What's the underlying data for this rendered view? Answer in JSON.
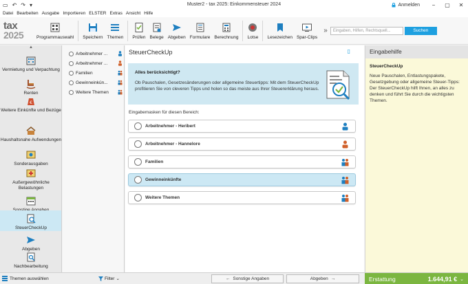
{
  "window": {
    "title": "Muster2 - tax 2025: Einkommensteuer 2024",
    "anmelden": "Anmelden"
  },
  "menu": [
    "Datei",
    "Bearbeiten",
    "Ausgabe",
    "Importieren",
    "ELSTER",
    "Extras",
    "Ansicht",
    "Hilfe"
  ],
  "logo": {
    "line1": "tax",
    "line2": "2025"
  },
  "toolbar": {
    "programmauswahl": "Programmauswahl",
    "speichern": "Speichern",
    "themen": "Themen",
    "pruefen": "Prüfen",
    "belege": "Belege",
    "abgeben": "Abgeben",
    "formulare": "Formulare",
    "berechnung": "Berechnung",
    "lotse": "Lotse",
    "lesezeichen": "Lesezeichen",
    "sparclips": "Spar-Clips",
    "more": "»",
    "search_placeholder": "Eingaben, Hilfen, Rechtsquell...",
    "search_button": "Suchen"
  },
  "sidebar": [
    {
      "label": "Vermietung und Verpachtung"
    },
    {
      "label": "Renten"
    },
    {
      "label": "Weitere Einkünfte und Bezüge"
    },
    {
      "label": "Haushaltsnahe Aufwendungen"
    },
    {
      "label": "Sonderausgaben"
    },
    {
      "label": "Außergewöhnliche Belastungen"
    },
    {
      "label": "Sonstige Angaben"
    },
    {
      "label": "SteuerCheckUp"
    },
    {
      "label": "Abgeben"
    },
    {
      "label": "Nachbearbeitung"
    }
  ],
  "navlist": [
    {
      "label": "Arbeitnehmer ..."
    },
    {
      "label": "Arbeitnehmer ..."
    },
    {
      "label": "Familien"
    },
    {
      "label": "Gewinneinkün..."
    },
    {
      "label": "Weitere Themen"
    }
  ],
  "content": {
    "title": "SteuerCheckUp",
    "info_title": "Alles berücksichtigt?",
    "info_text": "Ob Pauschalen, Gesetzesänderungen oder allgemeine Steuertipps: Mit dem SteuerCheckUp profitieren Sie von cleveren Tipps und holen so das meiste aus Ihrer Steuererklärung heraus.",
    "section_label": "Eingabemasken für diesen Bereich:",
    "choices": [
      {
        "label": "Arbeitnehmer - Heribert"
      },
      {
        "label": "Arbeitnehmer - Hannelore"
      },
      {
        "label": "Familien"
      },
      {
        "label": "Gewinneinkünfte"
      },
      {
        "label": "Weitere Themen"
      }
    ]
  },
  "right_panel": {
    "header": "Eingabehilfe",
    "title": "SteuerCheckUp",
    "text": "Neue Pauschalen, Entlastungspakete, Gesetzgebung oder allgemeine Steuer-Tipps: Der SteuerCheckUp hilft Ihnen, an alles zu denken und führt Sie durch die wichtigsten Themen."
  },
  "bottom": {
    "themen": "Themen auswählen",
    "filter": "Filter",
    "prev": "Sonstige Angaben",
    "next": "Abgeben",
    "refund_label": "Erstattung",
    "refund_amount": "1.644,91 €"
  },
  "colors": {
    "accent": "#1ea0e0",
    "selected": "#cce8f4",
    "info_bg": "#cfe8f2",
    "help_bg": "#fbf9d9",
    "refund": "#7bb640"
  }
}
